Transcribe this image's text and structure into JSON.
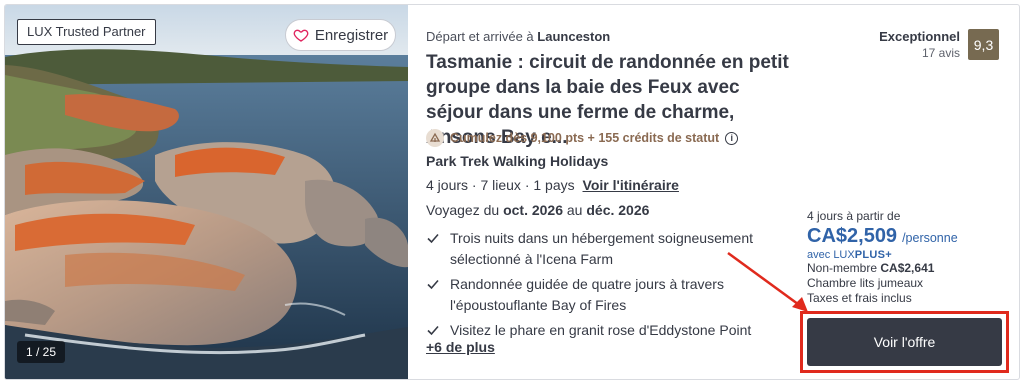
{
  "image": {
    "partner_badge": "LUX Trusted Partner",
    "save_label": "Enregistrer",
    "counter": "1 / 25"
  },
  "offer": {
    "departure_prefix": "Départ et arrivée à",
    "departure_city": "Launceston",
    "title": "Tasmanie : circuit de randonnée en petit groupe dans la baie des Feux avec séjour dans une ferme de charme, Ansons Bay e...",
    "points_text": "Cumulez dès 9,100 pts + 155 crédits de statut",
    "operator": "Park Trek Walking Holidays",
    "facts": "4 jours · 7 lieux · 1 pays",
    "itinerary_link": "Voir l'itinéraire",
    "travel_prefix": "Voyagez du",
    "travel_from": "oct. 2026",
    "travel_mid": "au",
    "travel_to": "déc. 2026",
    "highlights": [
      "Trois nuits dans un hébergement soigneusement sélectionné à l'Icena Farm",
      "Randonnée guidée de quatre jours à travers l'époustouflante Bay of Fires",
      "Visitez le phare en granit rose d'Eddystone Point"
    ],
    "more_link": "+6 de plus"
  },
  "rating": {
    "label": "Exceptionnel",
    "count": "17 avis",
    "score": "9,3"
  },
  "price": {
    "from_text": "4 jours à partir de",
    "amount": "CA$2,509",
    "per": "/personne",
    "lux_prefix": "avec",
    "lux_brand": "LUX",
    "lux_plus": "PLUS+",
    "nonmember_label": "Non-membre",
    "nonmember_price": "CA$2,641",
    "room": "Chambre lits jumeaux",
    "taxes": "Taxes et frais inclus",
    "cta_label": "Voir l'offre"
  },
  "colors": {
    "primary_blue": "#3063a8",
    "dark_button": "#363a45",
    "score_badge": "#776a51",
    "annotation_red": "#e02a1d"
  }
}
